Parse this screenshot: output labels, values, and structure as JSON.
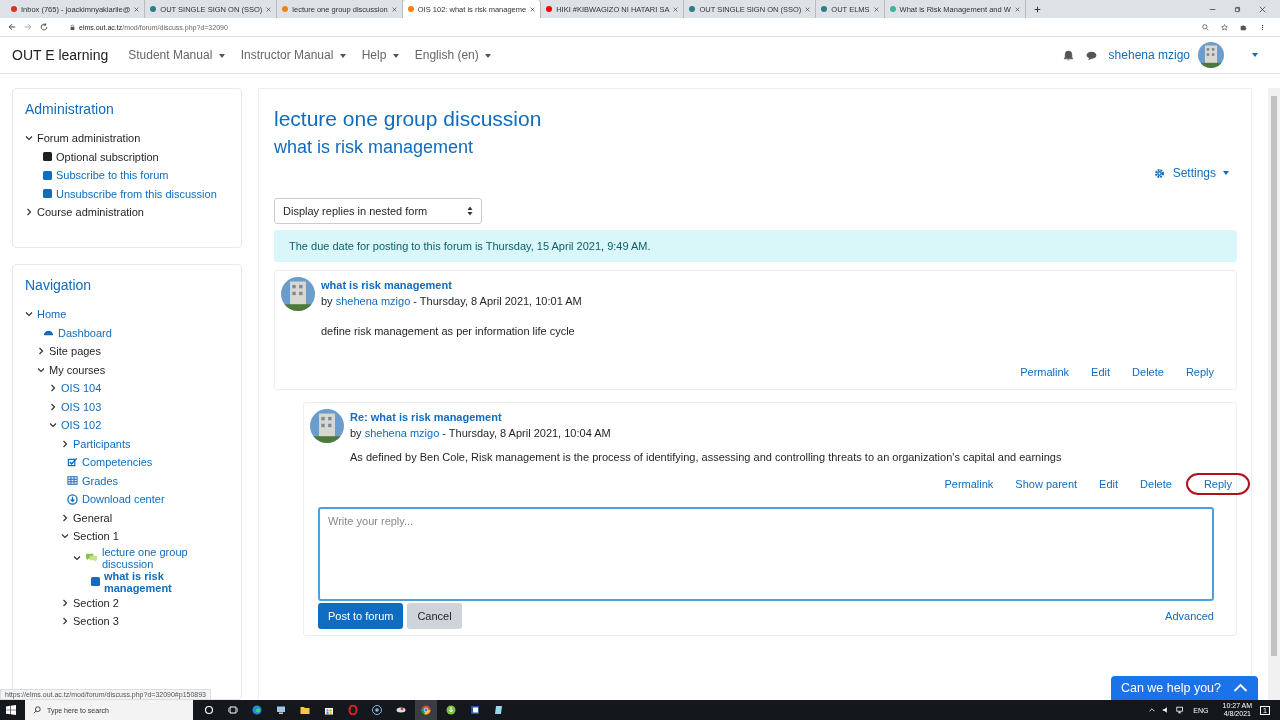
{
  "browser": {
    "tabs": [
      {
        "title": "Inbox (765) - joackimnyakiarile@",
        "selected": false
      },
      {
        "title": "OUT SINGLE SIGN ON (SSO)",
        "selected": false
      },
      {
        "title": "lecture one group discussion",
        "selected": false
      },
      {
        "title": "OIS 102: what is risk manageme",
        "selected": true
      },
      {
        "title": "HIKI #KIBWAGIZO NI HATARI SA",
        "selected": false
      },
      {
        "title": "OUT SINGLE SIGN ON (SSO)",
        "selected": false
      },
      {
        "title": "OUT ELMS",
        "selected": false
      },
      {
        "title": "What is Risk Management and W",
        "selected": false
      }
    ],
    "url_host": "elms.out.ac.tz",
    "url_path": "/mod/forum/discuss.php?d=32090"
  },
  "navbar": {
    "brand": "OUT E learning",
    "menus": [
      "Student Manual",
      "Instructor Manual",
      "Help",
      "English (en)"
    ],
    "user": "shehena mzigo"
  },
  "administration": {
    "title": "Administration",
    "items": [
      {
        "label": "Forum administration",
        "expanded": true,
        "children": [
          {
            "label": "Optional subscription",
            "kind": "dark-square"
          },
          {
            "label": "Subscribe to this forum",
            "kind": "square"
          },
          {
            "label": "Unsubscribe from this discussion",
            "kind": "square"
          }
        ]
      },
      {
        "label": "Course administration",
        "expanded": false
      }
    ]
  },
  "navigation": {
    "title": "Navigation",
    "items": [
      {
        "label": "Home",
        "expanded": true,
        "link": true,
        "selected": false,
        "children": [
          {
            "label": "Dashboard",
            "kind": "dashboard",
            "link": true,
            "selected": false
          },
          {
            "label": "Site pages",
            "expanded": false,
            "link": false,
            "selected": false
          },
          {
            "label": "My courses",
            "expanded": true,
            "link": false,
            "selected": false,
            "children": [
              {
                "label": "OIS 104",
                "expanded": false,
                "link": true,
                "selected": false
              },
              {
                "label": "OIS 103",
                "expanded": false,
                "link": true,
                "selected": false
              },
              {
                "label": "OIS 102",
                "expanded": true,
                "link": true,
                "selected": false,
                "children": [
                  {
                    "label": "Participants",
                    "expanded": false,
                    "link": true,
                    "selected": false
                  },
                  {
                    "label": "Competencies",
                    "kind": "check",
                    "link": true,
                    "selected": false
                  },
                  {
                    "label": "Grades",
                    "kind": "grades",
                    "link": true,
                    "selected": false
                  },
                  {
                    "label": "Download center",
                    "kind": "download",
                    "link": true,
                    "selected": false
                  },
                  {
                    "label": "General",
                    "expanded": false,
                    "link": false,
                    "selected": false
                  },
                  {
                    "label": "Section 1",
                    "expanded": true,
                    "link": false,
                    "selected": false,
                    "children": [
                      {
                        "label": "lecture one group discussion",
                        "kind": "forum",
                        "expanded": true,
                        "link": true,
                        "selected": false,
                        "children": [
                          {
                            "label": "what is risk management",
                            "kind": "square",
                            "link": true,
                            "selected": true
                          }
                        ]
                      }
                    ]
                  },
                  {
                    "label": "Section 2",
                    "expanded": false,
                    "link": false,
                    "selected": false
                  },
                  {
                    "label": "Section 3",
                    "expanded": false,
                    "link": false,
                    "selected": false
                  }
                ]
              }
            ]
          }
        ]
      }
    ]
  },
  "forum": {
    "title": "lecture one group discussion",
    "discussion": "what is risk management",
    "settings": "Settings",
    "display_mode": "Display replies in nested form",
    "notice": "The due date for posting to this forum is Thursday, 15 April 2021, 9:49 AM.",
    "posts": [
      {
        "subject": "what is risk management",
        "by": "by",
        "author": "shehena mzigo",
        "date": " - Thursday, 8 April 2021, 10:01 AM",
        "message": "define risk management as per information life cycle",
        "actions": [
          {
            "label": "Permalink",
            "circled": false
          },
          {
            "label": "Edit",
            "circled": false
          },
          {
            "label": "Delete",
            "circled": false
          },
          {
            "label": "Reply",
            "circled": false
          }
        ]
      },
      {
        "subject": "Re: what is risk management",
        "by": "by",
        "author": "shehena mzigo",
        "date": " - Thursday, 8 April 2021, 10:04 AM",
        "message": "As defined by Ben Cole, Risk management is the process of identifying, assessing and controlling threats to an organization's capital and earnings",
        "actions": [
          {
            "label": "Permalink",
            "circled": false
          },
          {
            "label": "Show parent",
            "circled": false
          },
          {
            "label": "Edit",
            "circled": false
          },
          {
            "label": "Delete",
            "circled": false
          },
          {
            "label": "Reply",
            "circled": true
          }
        ]
      }
    ],
    "reply": {
      "placeholder": "Write your reply...",
      "submit": "Post to forum",
      "cancel": "Cancel",
      "advanced": "Advanced"
    }
  },
  "status_url": "https://elms.out.ac.tz/mod/forum/discuss.php?d=32090#p150893",
  "chat": {
    "label": "Can we help you?"
  },
  "taskbar": {
    "search_placeholder": "Type here to search",
    "language": "ENG",
    "time": "10:27 AM",
    "date": "4/8/2021",
    "notifications": "1"
  }
}
